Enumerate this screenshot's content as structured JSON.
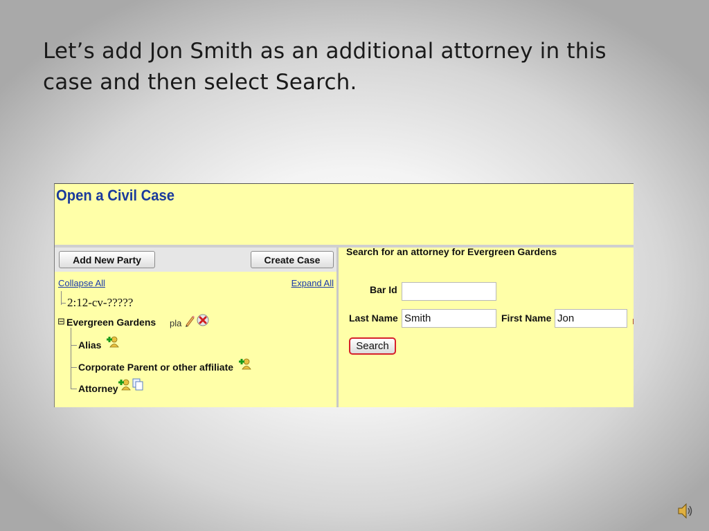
{
  "slide": {
    "heading": "Let’s add Jon Smith as an additional attorney in this case and then select Search."
  },
  "app": {
    "title": "Open a Civil Case",
    "toolbar": {
      "add_party_label": "Add New Party",
      "create_case_label": "Create Case"
    },
    "tree": {
      "collapse_all": "Collapse All",
      "expand_all": "Expand All",
      "case_number": "2:12-cv-?????",
      "collapse_toggle": "⊟",
      "party_name": "Evergreen Gardens",
      "party_role": "pla",
      "children": [
        "Alias",
        "Corporate Parent or other affiliate",
        "Attorney"
      ]
    },
    "search_form": {
      "heading": "Search for an attorney for Evergreen Gardens",
      "bar_id_label": "Bar Id",
      "bar_id_value": "",
      "last_name_label": "Last Name",
      "last_name_value": "Smith",
      "first_name_label": "First Name",
      "first_name_value": "Jon",
      "search_label": "Search"
    },
    "colors": {
      "background": "#ffffa8",
      "title": "#1a3a9c",
      "search_highlight": "#d6202a"
    }
  },
  "icons": {
    "edit": "pencil-icon",
    "delete": "delete-x-icon",
    "add": "add-person-icon",
    "copy": "copy-icon",
    "audio": "speaker-icon"
  }
}
